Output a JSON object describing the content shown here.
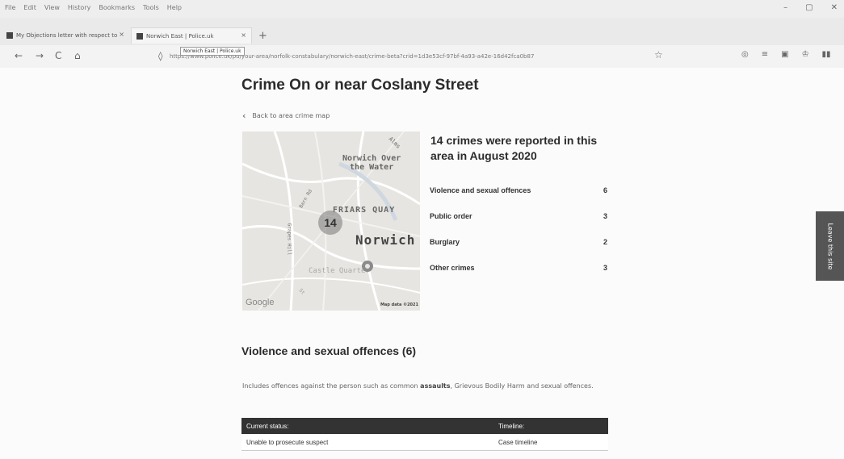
{
  "browser": {
    "menu": [
      "File",
      "Edit",
      "View",
      "History",
      "Bookmarks",
      "Tools",
      "Help"
    ],
    "window_controls": [
      "–",
      "▢",
      "✕"
    ],
    "tabs": [
      {
        "label": "My Objections letter with respect to"
      },
      {
        "label": "Norwich East | Police.uk"
      }
    ],
    "tab_close": "×",
    "new_tab": "+",
    "tooltip": "Norwich East | Police.uk",
    "url": "https://www.police.uk/pu/your-area/norfolk-constabulary/norwich-east/crime-beta?crid=1d3e53cf-97bf-4a93-a42e-16d42fca0b87",
    "nav": {
      "back": "←",
      "forward": "→",
      "reload": "C",
      "home": "⌂"
    },
    "icons": {
      "shield": "◊",
      "lock": "🔒",
      "star": "☆"
    },
    "toolbar_icons": [
      "◎",
      "≡",
      "▣",
      "♔",
      "▮▮",
      "≡"
    ]
  },
  "page": {
    "title": "Crime On or near Coslany Street",
    "back_link": "Back to area crime map",
    "back_chevron": "‹",
    "map": {
      "labels": {
        "over_the_water": "Norwich Over\nthe Water",
        "friars_quay": "FRIARS QUAY",
        "norwich": "Norwich",
        "castle": "Castle Quarter",
        "street_ne": "Alms",
        "road_1": "Barn Rd",
        "road_2": "Grapes Hill",
        "road_3": "St"
      },
      "cluster_count": "14",
      "google": "Google",
      "attribution": "Map data ©2021"
    },
    "summary_title": "14 crimes were reported in this area in August 2020",
    "crime_categories": [
      {
        "name": "Violence and sexual offences",
        "count": "6"
      },
      {
        "name": "Public order",
        "count": "3"
      },
      {
        "name": "Burglary",
        "count": "2"
      },
      {
        "name": "Other crimes",
        "count": "3"
      }
    ],
    "feedback": "Leave this site",
    "section": {
      "title": "Violence and sexual offences (6)",
      "desc_before": "Includes offences against the person such as common ",
      "desc_bold": "assaults",
      "desc_after": ", Grievous Bodily Harm and sexual offences.",
      "table": {
        "headers": [
          "Current status:",
          "Timeline:"
        ],
        "rows": [
          [
            "Unable to prosecute suspect",
            "Case timeline"
          ]
        ]
      }
    }
  }
}
